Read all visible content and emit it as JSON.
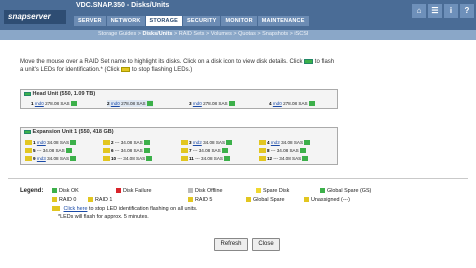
{
  "header": {
    "logo": "snapserver",
    "breadcrumb": "VDC.SNAP.350 - Disks/Units",
    "tabs": [
      "SERVER",
      "NETWORK",
      "STORAGE",
      "SECURITY",
      "MONITOR",
      "MAINTENANCE"
    ],
    "active_tab": "STORAGE",
    "icons": [
      "home-icon",
      "list-icon",
      "help-icon"
    ]
  },
  "subnav": {
    "items": [
      "Storage Guides",
      "Disks/Units",
      "RAID Sets",
      "Volumes",
      "Quotas",
      "Snapshots",
      "iSCSI"
    ],
    "active": "Disks/Units"
  },
  "instructions": {
    "line1": "Move the mouse over a RAID Set name to highlight its disks. Click on a disk icon to view disk details. Click",
    "line1b": "to flash",
    "line2": "a unit's LEDs for identification.* (Click",
    "line2b": "to stop flashing LEDs.)"
  },
  "head_unit": {
    "title": "Head Unit (550, 1.09 TB)",
    "disks": [
      {
        "num": "1",
        "raid": "md0",
        "size": "278.08 SAS"
      },
      {
        "num": "2",
        "raid": "md0",
        "size": "278.08 SAS"
      },
      {
        "num": "3",
        "raid": "md0",
        "size": "278.08 SAS"
      },
      {
        "num": "4",
        "raid": "md0",
        "size": "278.08 SAS"
      }
    ]
  },
  "expansion_unit": {
    "title": "Expansion Unit 1 (550, 418 GB)",
    "rows": [
      [
        {
          "num": "1",
          "raid": "md0",
          "size": "34.08 SAS"
        },
        {
          "num": "2",
          "raid": "---",
          "size": "34.08 SAS"
        },
        {
          "num": "3",
          "raid": "md2",
          "size": "34.08 SAS"
        },
        {
          "num": "4",
          "raid": "md2",
          "size": "34.08 SAS"
        }
      ],
      [
        {
          "num": "5",
          "raid": "---",
          "size": "34.08 SAS"
        },
        {
          "num": "6",
          "raid": "---",
          "size": "34.08 SAS"
        },
        {
          "num": "7",
          "raid": "---",
          "size": "34.08 SAS"
        },
        {
          "num": "8",
          "raid": "---",
          "size": "34.08 SAS"
        }
      ],
      [
        {
          "num": "9",
          "raid": "md3",
          "size": "34.08 SAS"
        },
        {
          "num": "10",
          "raid": "---",
          "size": "34.08 SAS"
        },
        {
          "num": "11",
          "raid": "---",
          "size": "34.08 SAS"
        },
        {
          "num": "12",
          "raid": "---",
          "size": "34.08 SAS"
        }
      ]
    ]
  },
  "legend": {
    "title": "Legend:",
    "row1": [
      "Disk OK",
      "Disk Failure",
      "Disk Offline",
      "Spare Disk",
      "Global Spare (GS)"
    ],
    "row2": [
      "RAID 0",
      "RAID 1",
      "RAID 5",
      "Global Spare",
      "Unassigned (---)"
    ],
    "stop_link": "Click here",
    "stop_text": "to stop LED identification flashing on all units.",
    "note": "*LEDs will flash for approx. 5 minutes."
  },
  "buttons": {
    "refresh": "Refresh",
    "close": "Close"
  },
  "colors": {
    "ok": "#3cb04a",
    "failure": "#d8232a",
    "offline": "#bbbbbb",
    "spare": "#f0d830",
    "global_spare": "#3cb04a",
    "raid0": "#e2c620",
    "raid1": "#e2c620",
    "raid5": "#e2c620",
    "unassigned": "#e2c620"
  }
}
